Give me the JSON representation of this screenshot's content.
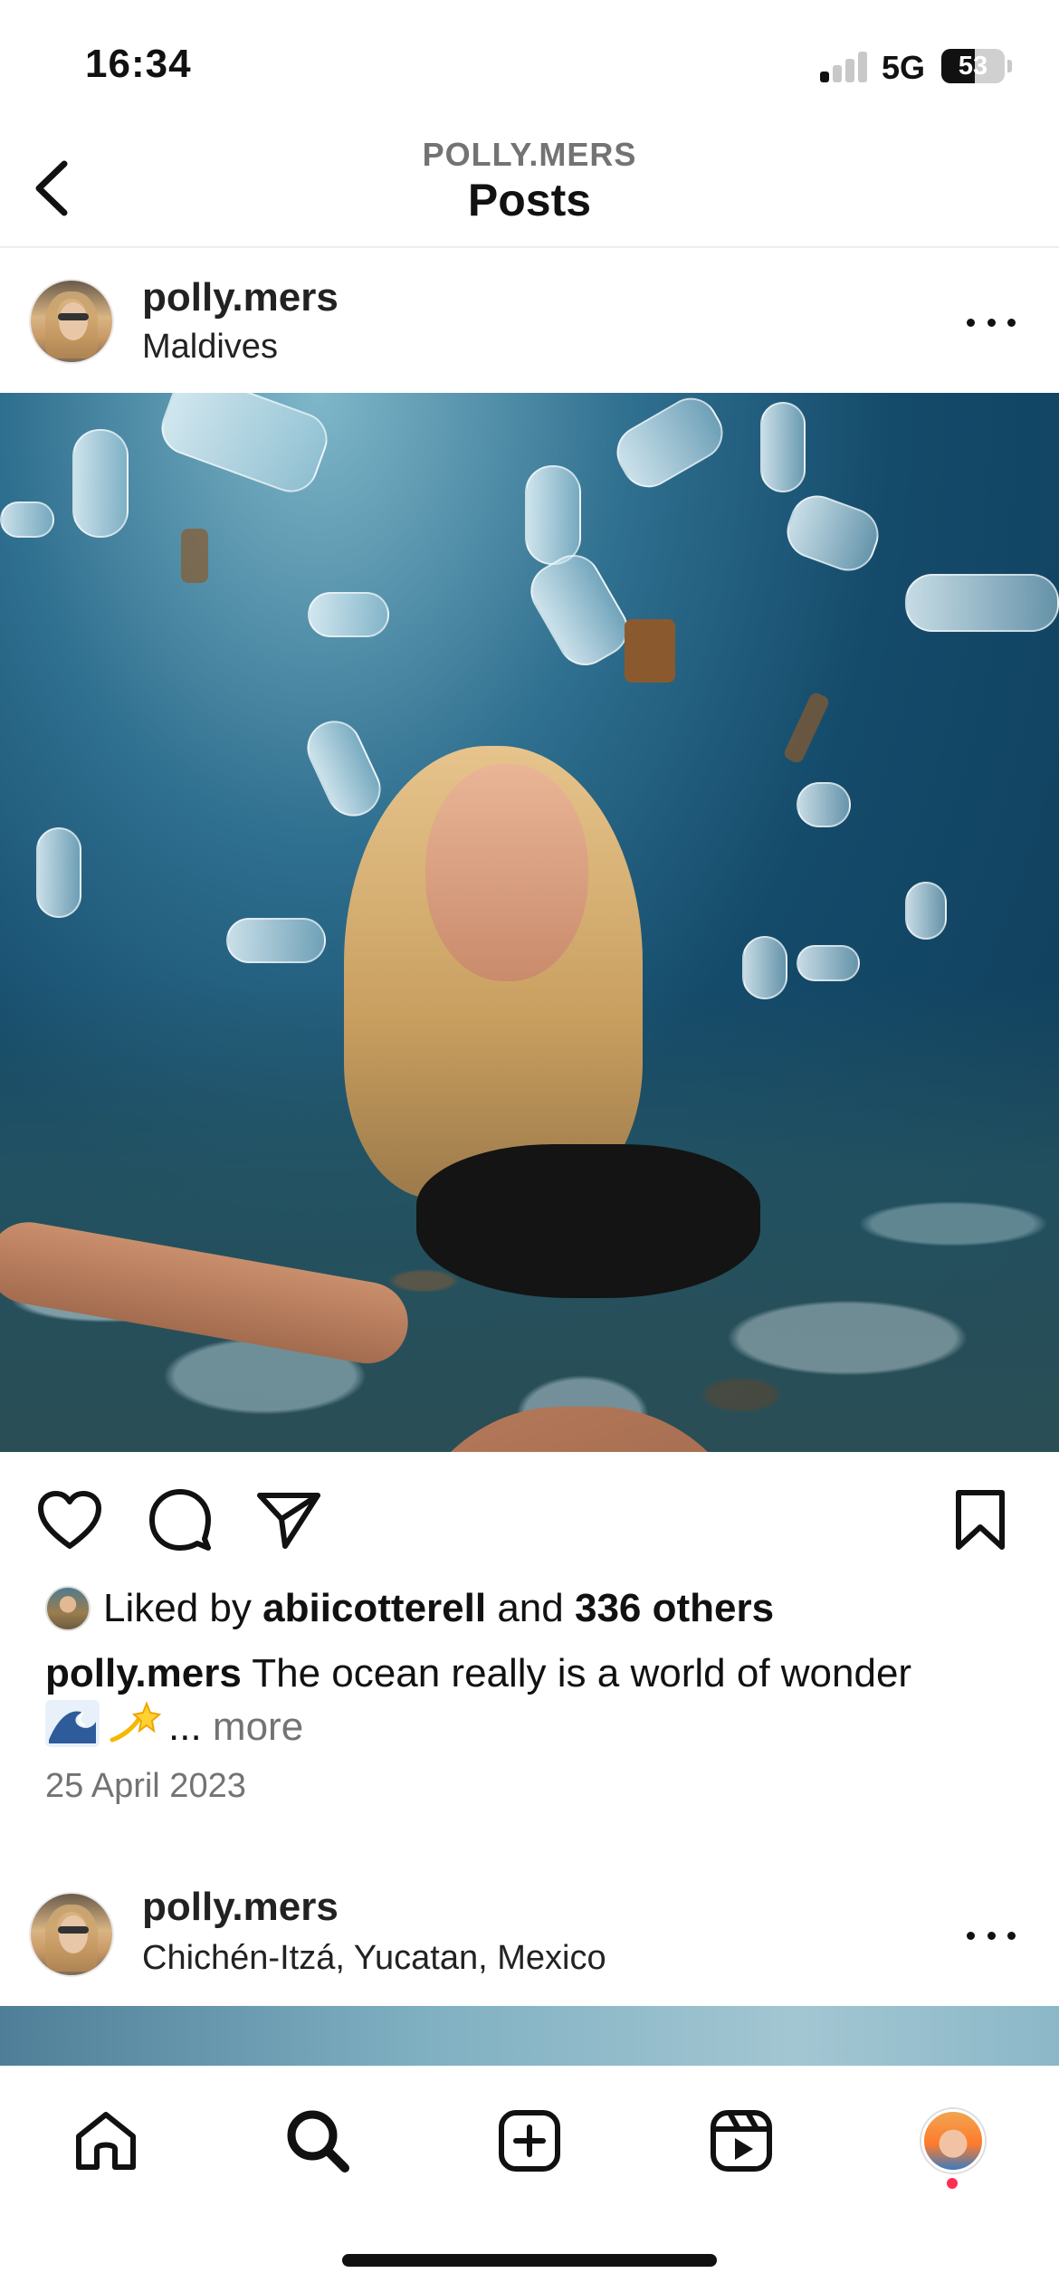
{
  "status_bar": {
    "time": "16:34",
    "network": "5G",
    "battery_percent": "53"
  },
  "header": {
    "account": "POLLY.MERS",
    "title": "Posts"
  },
  "post": {
    "username": "polly.mers",
    "location": "Maldives",
    "likes_prefix": "Liked by",
    "liked_by": "abiicotterell",
    "likes_and": "and",
    "likes_others": "336 others",
    "caption_user": "polly.mers",
    "caption_text": "The ocean really is a world of wonder",
    "caption_emojis": [
      "wave-emoji",
      "dizzy-emoji"
    ],
    "ellipsis": "...",
    "more_label": "more",
    "date": "25 April 2023"
  },
  "next_post": {
    "username": "polly.mers",
    "location": "Chichén-Itzá, Yucatan, Mexico"
  },
  "tabbar": {
    "items": [
      "home-icon",
      "search-icon",
      "create-post-icon",
      "reels-icon",
      "profile-avatar"
    ]
  },
  "colors": {
    "text": "#111111",
    "muted": "#737373",
    "notification": "#ff2d55"
  }
}
